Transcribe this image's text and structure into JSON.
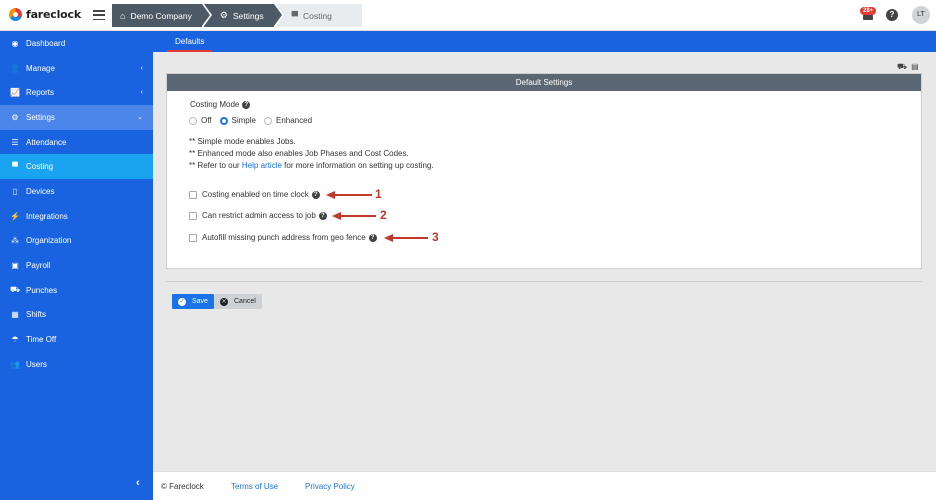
{
  "app": {
    "logo_text": "fareclock"
  },
  "breadcrumbs": [
    {
      "label": "Demo Company",
      "icon": "home-icon"
    },
    {
      "label": "Settings",
      "icon": "gear-icon"
    },
    {
      "label": "Costing",
      "icon": "briefcase-icon"
    }
  ],
  "header": {
    "notification_count": "28+",
    "help_label": "?",
    "user_initials": "LT"
  },
  "sidebar": {
    "items": [
      {
        "label": "Dashboard",
        "icon": "dashboard-icon"
      },
      {
        "label": "Manage",
        "icon": "user-icon",
        "chevron": "‹"
      },
      {
        "label": "Reports",
        "icon": "chart-icon",
        "chevron": "‹"
      },
      {
        "label": "Settings",
        "icon": "gear-icon",
        "chevron": "⌄"
      },
      {
        "label": "Attendance",
        "icon": "list-icon"
      },
      {
        "label": "Costing",
        "icon": "briefcase-icon"
      },
      {
        "label": "Devices",
        "icon": "tablet-icon"
      },
      {
        "label": "Integrations",
        "icon": "plug-icon"
      },
      {
        "label": "Organization",
        "icon": "sitemap-icon"
      },
      {
        "label": "Payroll",
        "icon": "money-icon"
      },
      {
        "label": "Punches",
        "icon": "truck-icon"
      },
      {
        "label": "Shifts",
        "icon": "calendar-icon"
      },
      {
        "label": "Time Off",
        "icon": "beach-icon"
      },
      {
        "label": "Users",
        "icon": "users-icon"
      }
    ],
    "collapse_label": "‹",
    "colors": {
      "background": "#1a63e0",
      "active_parent": "#4d86ea",
      "active_child": "#1aa3f0"
    }
  },
  "tabs": {
    "active": "Defaults"
  },
  "panel": {
    "title": "Default Settings",
    "costing_mode_label": "Costing Mode",
    "modes": [
      {
        "label": "Off",
        "checked": false
      },
      {
        "label": "Simple",
        "checked": true
      },
      {
        "label": "Enhanced",
        "checked": false
      }
    ],
    "notes": {
      "line1": "** Simple mode enables Jobs.",
      "line2": "** Enhanced mode also enables Job Phases and Cost Codes.",
      "line3_prefix": "** Refer to our ",
      "line3_link": "Help article",
      "line3_suffix": " for more information on setting up costing."
    },
    "checkboxes": [
      {
        "label": "Costing enabled on time clock",
        "checked": false,
        "annotation": "1"
      },
      {
        "label": "Can restrict admin access to job",
        "checked": false,
        "annotation": "2"
      },
      {
        "label": "Autofill missing punch address from geo fence",
        "checked": false,
        "annotation": "3"
      }
    ]
  },
  "actions": {
    "save_label": "Save",
    "cancel_label": "Cancel"
  },
  "footer": {
    "copyright": "© Fareclock",
    "terms": "Terms of Use",
    "privacy": "Privacy Policy"
  },
  "colors": {
    "accent": "#1a73e8",
    "annotation_arrow": "#c0392b",
    "panel_header": "#5b6873"
  }
}
